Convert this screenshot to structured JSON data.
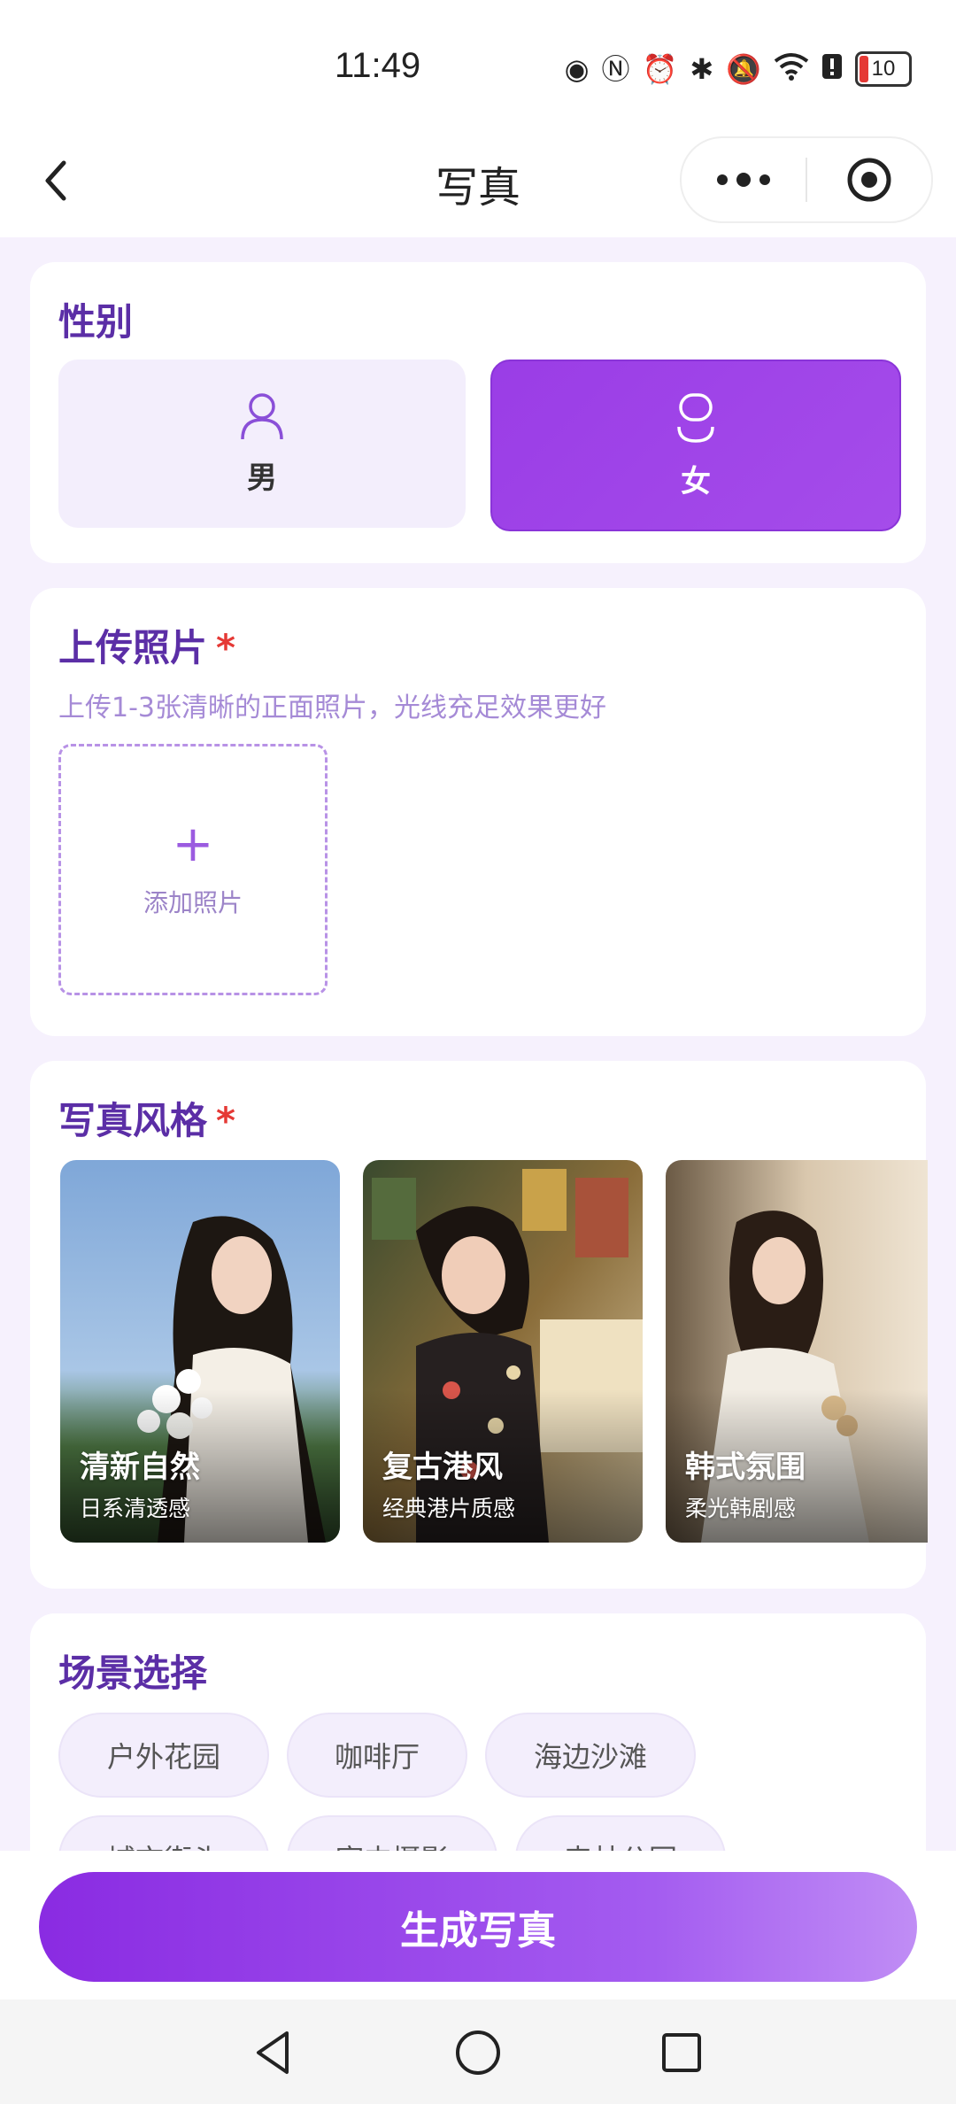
{
  "status_bar": {
    "time": "11:49",
    "battery": "10"
  },
  "nav": {
    "title": "写真"
  },
  "gender": {
    "title": "性别",
    "options": [
      {
        "label": "男",
        "selected": false
      },
      {
        "label": "女",
        "selected": true
      }
    ]
  },
  "upload": {
    "title": "上传照片",
    "required_mark": "*",
    "hint": "上传1-3张清晰的正面照片，光线充足效果更好",
    "add_icon": "+",
    "add_label": "添加照片"
  },
  "style": {
    "title": "写真风格",
    "required_mark": "*",
    "items": [
      {
        "name": "清新自然",
        "desc": "日系清透感"
      },
      {
        "name": "复古港风",
        "desc": "经典港片质感"
      },
      {
        "name": "韩式氛围",
        "desc": "柔光韩剧感"
      }
    ]
  },
  "scene": {
    "title": "场景选择",
    "chips": [
      "户外花园",
      "咖啡厅",
      "海边沙滩",
      "城市街头",
      "室内摄影",
      "森林公园"
    ]
  },
  "generate_button": "生成写真",
  "colors": {
    "accent": "#8a2be2",
    "title": "#5b2ea6",
    "required": "#e53935"
  }
}
